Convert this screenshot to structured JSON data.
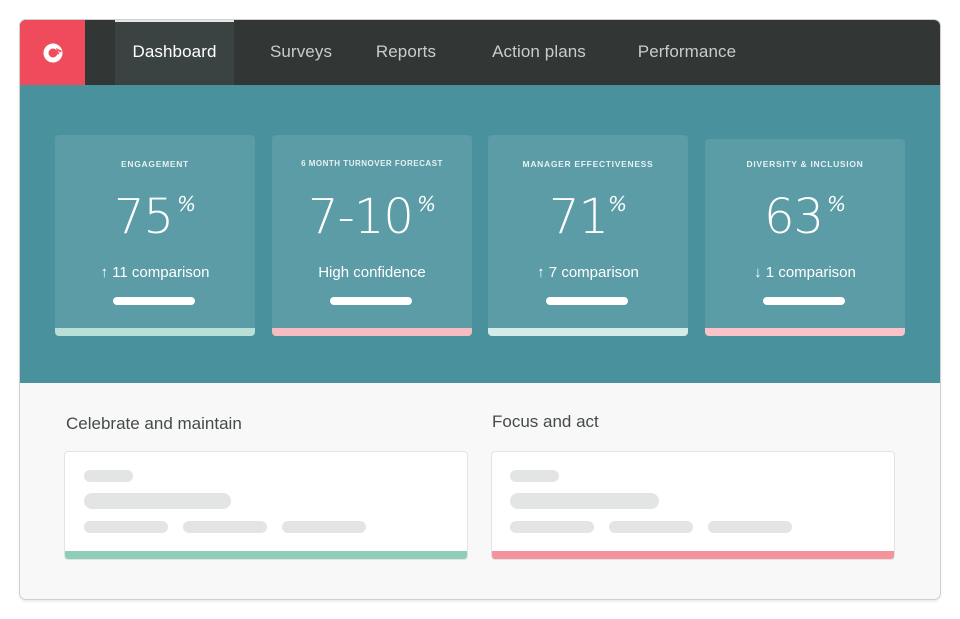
{
  "app": {
    "logo_icon": "brand-swirl-logo",
    "brand_color": "#f04b5c"
  },
  "nav": {
    "items": [
      {
        "label": "Dashboard",
        "active": true
      },
      {
        "label": "Surveys",
        "active": false
      },
      {
        "label": "Reports",
        "active": false
      },
      {
        "label": "Action plans",
        "active": false
      },
      {
        "label": "Performance",
        "active": false
      }
    ]
  },
  "kpis": [
    {
      "label": "ENGAGEMENT",
      "value": "75",
      "unit": "%",
      "sub": "↑ 11 comparison",
      "trend": "up",
      "accent": "#b9dfd6"
    },
    {
      "label": "6 MONTH TURNOVER FORECAST",
      "value": "7-10",
      "unit": "%",
      "sub": "High confidence",
      "trend": "none",
      "accent": "#f6bcc2"
    },
    {
      "label": "MANAGER EFFECTIVENESS",
      "value": "71",
      "unit": "%",
      "sub": "↑ 7 comparison",
      "trend": "up",
      "accent": "#d4ece6"
    },
    {
      "label": "DIVERSITY & INCLUSION",
      "value": "63",
      "unit": "%",
      "sub": "↓ 1 comparison",
      "trend": "down",
      "accent": "#f9c3c8"
    }
  ],
  "sections": [
    {
      "title": "Celebrate and maintain",
      "accent": "#8dcdb9"
    },
    {
      "title": "Focus and act",
      "accent": "#f4939b"
    }
  ]
}
